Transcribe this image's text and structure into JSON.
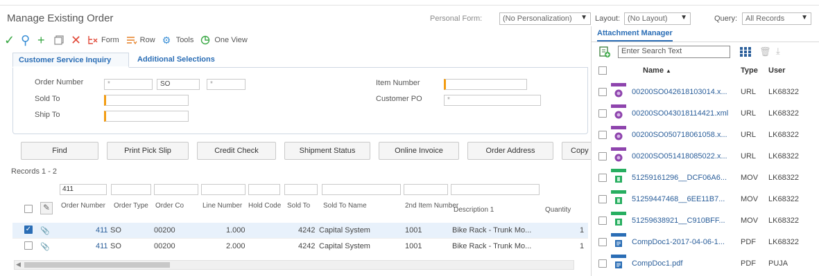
{
  "window": {
    "title": "Manage Existing Order"
  },
  "header": {
    "personal_form_label": "Personal Form:",
    "personal_form_value": "(No Personalization)",
    "layout_label": "Layout:",
    "layout_value": "(No Layout)",
    "query_label": "Query:",
    "query_value": "All Records"
  },
  "toolbar": {
    "form": "Form",
    "row": "Row",
    "tools": "Tools",
    "one_view": "One View"
  },
  "tabs": [
    "Customer Service Inquiry",
    "Additional Selections"
  ],
  "form": {
    "order_number_label": "Order Number",
    "order_number_value": "*",
    "order_type_value": "SO",
    "order_co_value": "*",
    "sold_to_label": "Sold To",
    "ship_to_label": "Ship To",
    "item_number_label": "Item Number",
    "customer_po_label": "Customer PO",
    "customer_po_value": "*"
  },
  "buttons": [
    "Find",
    "Print Pick Slip",
    "Credit Check",
    "Shipment Status",
    "Online Invoice",
    "Order Address",
    "Copy"
  ],
  "records_label": "Records 1 - 2",
  "grid": {
    "filter_order_number": "411",
    "columns": {
      "order_number": "Order Number",
      "order_type": "Order Type",
      "order_co": "Order Co",
      "line_number": "Line Number",
      "hold_code": "Hold Code",
      "sold_to": "Sold To",
      "sold_to_name": "Sold To Name",
      "second_item": "2nd Item Number",
      "description": "Description 1",
      "quantity": "Quantity"
    },
    "rows": [
      {
        "checked": true,
        "order_number": "411",
        "order_type": "SO",
        "order_co": "00200",
        "line_number": "1.000",
        "sold_to": "4242",
        "sold_to_name": "Capital System",
        "second_item": "1001",
        "description": "Bike Rack - Trunk Mo...",
        "quantity": "1"
      },
      {
        "checked": false,
        "order_number": "411",
        "order_type": "SO",
        "order_co": "00200",
        "line_number": "2.000",
        "sold_to": "4242",
        "sold_to_name": "Capital System",
        "second_item": "1001",
        "description": "Bike Rack - Trunk Mo...",
        "quantity": "1"
      }
    ]
  },
  "attachments": {
    "tab_label": "Attachment Manager",
    "search_placeholder": "Enter Search Text",
    "col_name": "Name",
    "col_type": "Type",
    "col_user": "User",
    "items": [
      {
        "name": "00200SO042618103014.x...",
        "type": "URL",
        "user": "LK68322",
        "color": "#8e44ad",
        "icon": "url-icon"
      },
      {
        "name": "00200SO043018114421.xml",
        "type": "URL",
        "user": "LK68322",
        "color": "#8e44ad",
        "icon": "url-icon"
      },
      {
        "name": "00200SO050718061058.x...",
        "type": "URL",
        "user": "LK68322",
        "color": "#8e44ad",
        "icon": "url-icon"
      },
      {
        "name": "00200SO051418085022.x...",
        "type": "URL",
        "user": "LK68322",
        "color": "#8e44ad",
        "icon": "url-icon"
      },
      {
        "name": "51259161296__DCF06A6...",
        "type": "MOV",
        "user": "LK68322",
        "color": "#27ae60",
        "icon": "movie-icon"
      },
      {
        "name": "51259447468__6EE11B7...",
        "type": "MOV",
        "user": "LK68322",
        "color": "#27ae60",
        "icon": "movie-icon"
      },
      {
        "name": "51259638921__C910BFF...",
        "type": "MOV",
        "user": "LK68322",
        "color": "#27ae60",
        "icon": "movie-icon"
      },
      {
        "name": "CompDoc1-2017-04-06-1...",
        "type": "PDF",
        "user": "LK68322",
        "color": "#2a6db5",
        "icon": "document-icon"
      },
      {
        "name": "CompDoc1.pdf",
        "type": "PDF",
        "user": "PUJA",
        "color": "#2a6db5",
        "icon": "document-icon"
      }
    ]
  }
}
